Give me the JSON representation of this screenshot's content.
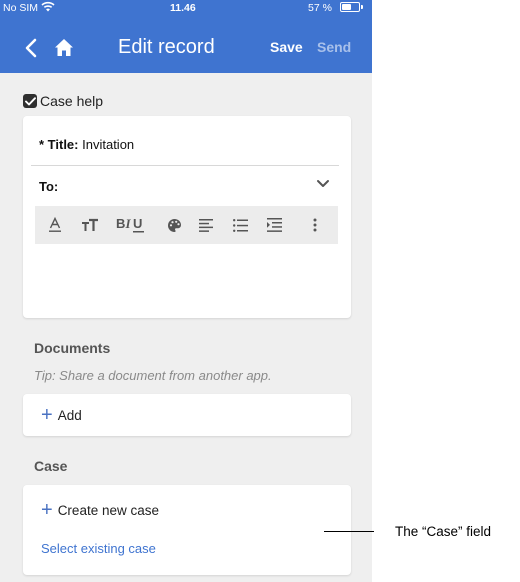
{
  "status_bar": {
    "carrier": "No SIM",
    "time": "11.46",
    "battery": "57 %",
    "battery_level": 0.57
  },
  "nav": {
    "title": "Edit record",
    "save_label": "Save",
    "send_label": "Send",
    "back_icon": "chevron-left-icon",
    "home_icon": "home-icon"
  },
  "case_help": {
    "label": "Case help",
    "checked": true
  },
  "editor": {
    "title_label": "* Title:",
    "title_value": "Invitation",
    "to_label": "To:",
    "toolbar": [
      "font-color-icon",
      "text-size-icon",
      "bold-italic-underline-icon",
      "palette-icon",
      "align-icon",
      "bulleted-list-icon",
      "indent-icon",
      "more-icon"
    ]
  },
  "documents": {
    "heading": "Documents",
    "tip": "Tip: Share a document from another app.",
    "add_label": "Add"
  },
  "case": {
    "heading": "Case",
    "create_label": "Create new case",
    "select_label": "Select existing case"
  },
  "callout": {
    "text": "The “Case” field"
  },
  "colors": {
    "header": "#3f74d0",
    "background": "#efefef",
    "link": "#3f74d0",
    "send_disabled": "#a8c0ea"
  }
}
